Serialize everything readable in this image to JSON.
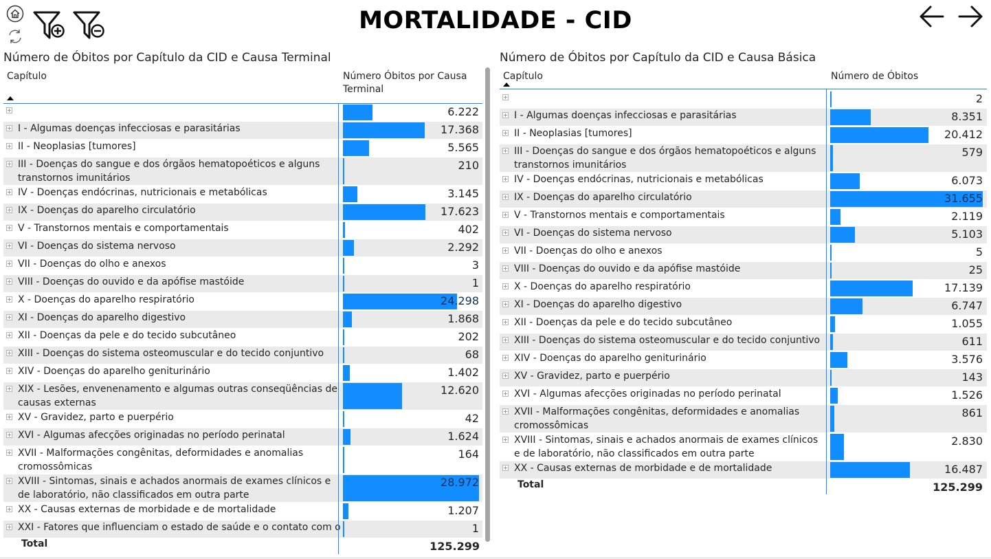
{
  "page": {
    "title": "MORTALIDADE - CID"
  },
  "toolbar": {
    "icons": [
      "home-icon",
      "refresh-icon",
      "filter-add-icon",
      "filter-remove-icon",
      "arrow-left-icon",
      "arrow-right-icon"
    ]
  },
  "left_table": {
    "title": "Número de Óbitos por Capítulo da CID e Causa Terminal",
    "col_chapter": "Capítulo",
    "col_value": "Número Óbitos por Causa Terminal",
    "max": 28972,
    "rows": [
      {
        "label": "",
        "value": "6.222",
        "num": 6222
      },
      {
        "label": "I - Algumas doenças infecciosas e parasitárias",
        "value": "17.368",
        "num": 17368
      },
      {
        "label": "II - Neoplasias [tumores]",
        "value": "5.565",
        "num": 5565
      },
      {
        "label": "III - Doenças do sangue e dos órgãos hematopoéticos e alguns transtornos imunitários",
        "value": "210",
        "num": 210
      },
      {
        "label": "IV - Doenças endócrinas, nutricionais e metabólicas",
        "value": "3.145",
        "num": 3145
      },
      {
        "label": "IX - Doenças do aparelho circulatório",
        "value": "17.623",
        "num": 17623
      },
      {
        "label": "V - Transtornos mentais e comportamentais",
        "value": "402",
        "num": 402
      },
      {
        "label": "VI - Doenças do sistema nervoso",
        "value": "2.292",
        "num": 2292
      },
      {
        "label": "VII - Doenças do olho e anexos",
        "value": "3",
        "num": 3
      },
      {
        "label": "VIII - Doenças do ouvido e da apófise mastóide",
        "value": "1",
        "num": 1
      },
      {
        "label": "X - Doenças do aparelho respiratório",
        "value": "24.298",
        "num": 24298
      },
      {
        "label": "XI - Doenças do aparelho digestivo",
        "value": "1.868",
        "num": 1868
      },
      {
        "label": "XII - Doenças da pele e do tecido subcutâneo",
        "value": "202",
        "num": 202
      },
      {
        "label": "XIII - Doenças do sistema osteomuscular e do tecido conjuntivo",
        "value": "68",
        "num": 68
      },
      {
        "label": "XIV - Doenças do aparelho geniturinário",
        "value": "1.402",
        "num": 1402
      },
      {
        "label": "XIX - Lesões, envenenamento e algumas outras conseqüências de causas externas",
        "value": "12.620",
        "num": 12620
      },
      {
        "label": "XV - Gravidez, parto e puerpério",
        "value": "42",
        "num": 42
      },
      {
        "label": "XVI - Algumas afecções originadas no período perinatal",
        "value": "1.624",
        "num": 1624
      },
      {
        "label": "XVII - Malformações congênitas, deformidades e anomalias cromossômicas",
        "value": "164",
        "num": 164
      },
      {
        "label": "XVIII - Sintomas, sinais e achados anormais de exames clínicos e de laboratório, não classificados em outra parte",
        "value": "28.972",
        "num": 28972
      },
      {
        "label": "XX - Causas externas de morbidade e de mortalidade",
        "value": "1.207",
        "num": 1207
      },
      {
        "label": "XXI - Fatores que influenciam o estado de saúde e o contato com os",
        "value": "1",
        "num": 1
      }
    ],
    "total_label": "Total",
    "total_value": "125.299"
  },
  "right_table": {
    "title": "Número de Óbitos por Capítulo da CID e Causa Básica",
    "col_chapter": "Capítulo",
    "col_value": "Número de Óbitos",
    "max": 31655,
    "rows": [
      {
        "label": "",
        "value": "2",
        "num": 2
      },
      {
        "label": "I - Algumas doenças infecciosas e parasitárias",
        "value": "8.351",
        "num": 8351
      },
      {
        "label": "II - Neoplasias [tumores]",
        "value": "20.412",
        "num": 20412
      },
      {
        "label": "III - Doenças do sangue e dos órgãos hematopoéticos e alguns transtornos imunitários",
        "value": "579",
        "num": 579
      },
      {
        "label": "IV - Doenças endócrinas, nutricionais e metabólicas",
        "value": "6.073",
        "num": 6073
      },
      {
        "label": "IX - Doenças do aparelho circulatório",
        "value": "31.655",
        "num": 31655
      },
      {
        "label": "V - Transtornos mentais e comportamentais",
        "value": "2.119",
        "num": 2119
      },
      {
        "label": "VI - Doenças do sistema nervoso",
        "value": "5.103",
        "num": 5103
      },
      {
        "label": "VII - Doenças do olho e anexos",
        "value": "5",
        "num": 5
      },
      {
        "label": "VIII - Doenças do ouvido e da apófise mastóide",
        "value": "25",
        "num": 25
      },
      {
        "label": "X - Doenças do aparelho respiratório",
        "value": "17.139",
        "num": 17139
      },
      {
        "label": "XI - Doenças do aparelho digestivo",
        "value": "6.747",
        "num": 6747
      },
      {
        "label": "XII - Doenças da pele e do tecido subcutâneo",
        "value": "1.055",
        "num": 1055
      },
      {
        "label": "XIII - Doenças do sistema osteomuscular e do tecido conjuntivo",
        "value": "611",
        "num": 611
      },
      {
        "label": "XIV - Doenças do aparelho geniturinário",
        "value": "3.576",
        "num": 3576
      },
      {
        "label": "XV - Gravidez, parto e puerpério",
        "value": "143",
        "num": 143
      },
      {
        "label": "XVI - Algumas afecções originadas no período perinatal",
        "value": "1.526",
        "num": 1526
      },
      {
        "label": "XVII - Malformações congênitas, deformidades e anomalias cromossômicas",
        "value": "861",
        "num": 861
      },
      {
        "label": "XVIII - Sintomas, sinais e achados anormais de exames clínicos e de laboratório, não classificados em outra parte",
        "value": "2.830",
        "num": 2830
      },
      {
        "label": "XX - Causas externas de morbidade e de mortalidade",
        "value": "16.487",
        "num": 16487
      }
    ],
    "total_label": "Total",
    "total_value": "125.299"
  },
  "colors": {
    "bar": "#118dff",
    "row_alt": "#eaeaea",
    "accent_line": "#118dff"
  }
}
